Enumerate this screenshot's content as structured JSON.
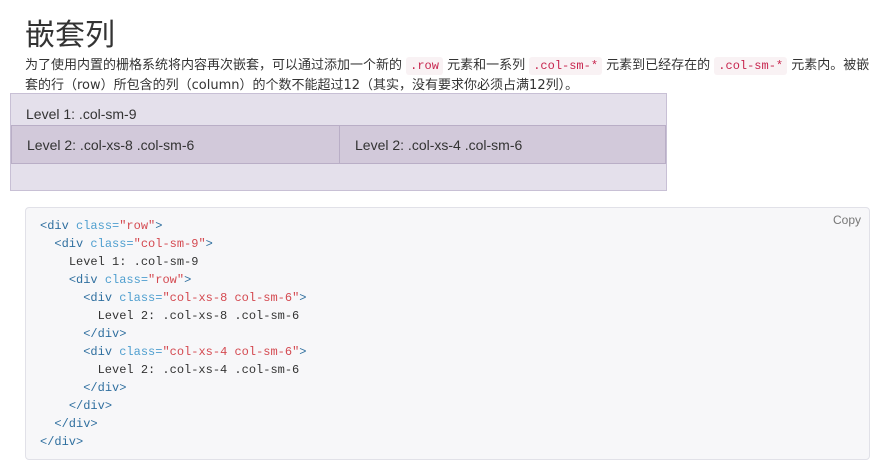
{
  "title": "嵌套列",
  "description": {
    "part1": "为了使用内置的栅格系统将内容再次嵌套，可以通过添加一个新的 ",
    "code1": ".row",
    "part2": " 元素和一系列 ",
    "code2": ".col-sm-*",
    "part3": " 元素到已经存在的 ",
    "code3": ".col-sm-*",
    "part4": " 元素内。被嵌套的行（row）所包含的列（column）的个数不能超过12（其实，没有要求你必须占满12列）。"
  },
  "demo": {
    "level1": "Level 1: .col-sm-9",
    "level2_left": "Level 2: .col-xs-8 .col-sm-6",
    "level2_right": "Level 2: .col-xs-4 .col-sm-6"
  },
  "code": {
    "copy_label": "Copy",
    "lines": [
      {
        "indent": "",
        "open": "<div",
        "attr": " class=",
        "val": "\"row\"",
        "close": ">"
      },
      {
        "indent": "  ",
        "open": "<div",
        "attr": " class=",
        "val": "\"col-sm-9\"",
        "close": ">"
      },
      {
        "indent": "    ",
        "text": "Level 1: .col-sm-9"
      },
      {
        "indent": "    ",
        "open": "<div",
        "attr": " class=",
        "val": "\"row\"",
        "close": ">"
      },
      {
        "indent": "      ",
        "open": "<div",
        "attr": " class=",
        "val": "\"col-xs-8 col-sm-6\"",
        "close": ">"
      },
      {
        "indent": "        ",
        "text": "Level 2: .col-xs-8 .col-sm-6"
      },
      {
        "indent": "      ",
        "end": "</div>"
      },
      {
        "indent": "      ",
        "open": "<div",
        "attr": " class=",
        "val": "\"col-xs-4 col-sm-6\"",
        "close": ">"
      },
      {
        "indent": "        ",
        "text": "Level 2: .col-xs-4 .col-sm-6"
      },
      {
        "indent": "      ",
        "end": "</div>"
      },
      {
        "indent": "    ",
        "end": "</div>"
      },
      {
        "indent": "  ",
        "end": "</div>"
      },
      {
        "indent": "",
        "end": "</div>"
      }
    ]
  }
}
